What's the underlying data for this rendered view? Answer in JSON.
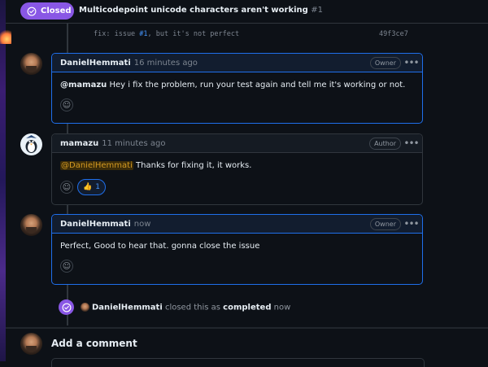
{
  "issue": {
    "state": "Closed",
    "title": "Multicodepoint unicode characters aren't working",
    "number": "#1",
    "state_color": "#8957e5"
  },
  "commit": {
    "message_prefix": "fix: issue ",
    "issue_link": "#1",
    "message_suffix": ", but it's not perfect",
    "sha": "49f3ce7"
  },
  "comments": [
    {
      "author": "DanielHemmati",
      "time": "16 minutes ago",
      "role": "Owner",
      "mention": "@mamazu",
      "body": " Hey i fix the problem, run your test again and tell me it's working or not.",
      "avatar": "person-avatar"
    },
    {
      "author": "mamazu",
      "time": "11 minutes ago",
      "role": "Author",
      "mention": "@DanielHemmati",
      "body": " Thanks for fixing it, it works.",
      "reaction": {
        "emoji": "👍",
        "count": "1"
      },
      "avatar": "penguin-avatar"
    },
    {
      "author": "DanielHemmati",
      "time": "now",
      "role": "Owner",
      "body": "Perfect, Good to hear that. gonna close the issue",
      "avatar": "person-avatar"
    }
  ],
  "close_event": {
    "actor": "DanielHemmati",
    "text_before": " closed this as ",
    "state": "completed",
    "time": " now"
  },
  "add_comment": {
    "heading": "Add a comment"
  },
  "icons": {
    "state": "check-circle-icon",
    "kebab": "kebab-horizontal-icon",
    "reaction": "smiley-icon"
  }
}
